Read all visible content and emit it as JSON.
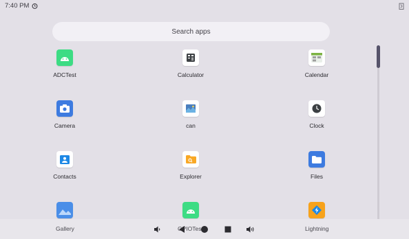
{
  "status": {
    "time": "7:40 PM"
  },
  "search": {
    "placeholder": "Search apps"
  },
  "apps": [
    {
      "label": "ADCTest",
      "icon": "android-icon",
      "color": "#3ddc84"
    },
    {
      "label": "Calculator",
      "icon": "calculator-icon",
      "color": "#ffffff"
    },
    {
      "label": "Calendar",
      "icon": "calendar-icon",
      "color": "#ffffff"
    },
    {
      "label": "Camera",
      "icon": "camera-icon",
      "color": "#3d7be0"
    },
    {
      "label": "can",
      "icon": "can-icon",
      "color": "#ffffff"
    },
    {
      "label": "Clock",
      "icon": "clock-icon",
      "color": "#ffffff"
    },
    {
      "label": "Contacts",
      "icon": "contacts-icon",
      "color": "#ffffff"
    },
    {
      "label": "Explorer",
      "icon": "folder-explorer-icon",
      "color": "#ffffff"
    },
    {
      "label": "Files",
      "icon": "files-folder-icon",
      "color": "#3d7be0"
    },
    {
      "label": "Gallery",
      "icon": "gallery-icon",
      "color": "#4a8ee8"
    },
    {
      "label": "GPIOTest",
      "icon": "android-icon",
      "color": "#3ddc84"
    },
    {
      "label": "Lightning",
      "icon": "lightning-icon",
      "color": "#f7a21b"
    }
  ],
  "navigation": [
    {
      "name": "volume-down-icon"
    },
    {
      "name": "back-icon"
    },
    {
      "name": "home-icon"
    },
    {
      "name": "recents-icon"
    },
    {
      "name": "volume-up-icon"
    }
  ],
  "colors": {
    "background": "#e3e0e7",
    "scroll_thumb": "#56536a",
    "search_bg": "#f2f0f5"
  }
}
